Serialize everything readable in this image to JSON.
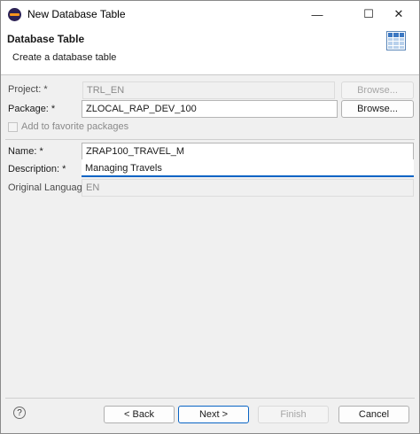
{
  "window": {
    "title": "New Database Table",
    "controls": {
      "minimize": "—",
      "maximize": "☐",
      "close": "✕"
    }
  },
  "banner": {
    "title": "Database Table",
    "subtitle": "Create a database table",
    "icon": "table-icon"
  },
  "form": {
    "project": {
      "label": "Project: *",
      "value": "TRL_EN",
      "browse": "Browse..."
    },
    "package": {
      "label": "Package: *",
      "value": "ZLOCAL_RAP_DEV_100",
      "browse": "Browse..."
    },
    "favorite": {
      "label": "Add to favorite packages",
      "checked": false
    },
    "name": {
      "label": "Name: *",
      "value": "ZRAP100_TRAVEL_M"
    },
    "description": {
      "label": "Description: *",
      "value": "Managing Travels"
    },
    "language": {
      "label": "Original Language:",
      "value": "EN"
    }
  },
  "footer": {
    "help": "?",
    "back": "< Back",
    "next": "Next >",
    "finish": "Finish",
    "cancel": "Cancel"
  },
  "colors": {
    "accent": "#0a64c4",
    "background": "#f0f0f0"
  }
}
